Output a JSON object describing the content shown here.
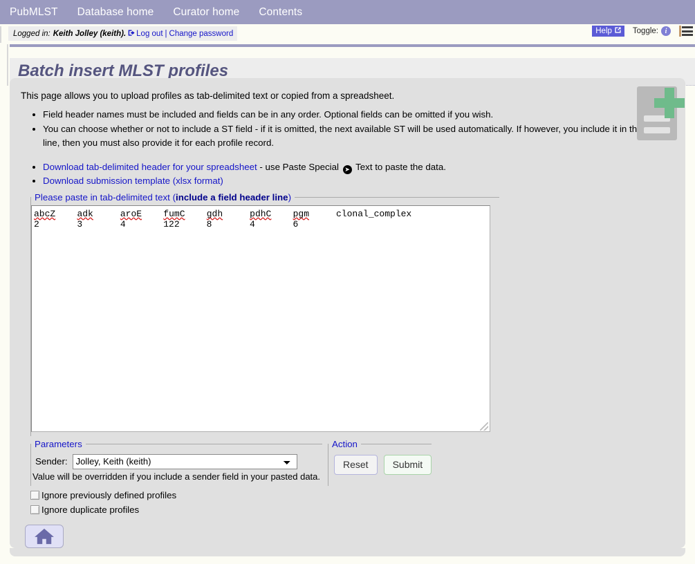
{
  "nav": {
    "items": [
      {
        "label": "PubMLST",
        "name": "nav-pubmlst"
      },
      {
        "label": "Database home",
        "name": "nav-database-home"
      },
      {
        "label": "Curator home",
        "name": "nav-curator-home"
      },
      {
        "label": "Contents",
        "name": "nav-contents"
      }
    ]
  },
  "login_bar": {
    "logged_in_prefix": "Logged in:",
    "user": "Keith Jolley (keith).",
    "logout_label": "Log out",
    "separator": "|",
    "change_password_label": "Change password",
    "help_label": "Help",
    "toggle_label": "Toggle:"
  },
  "page": {
    "title": "Batch insert MLST profiles"
  },
  "intro": {
    "text": "This page allows you to upload profiles as tab-delimited text or copied from a spreadsheet.",
    "bullets": [
      "Field header names must be included and fields can be in any order. Optional fields can be omitted if you wish.",
      "You can choose whether or not to include a ST field - if it is omitted, the next available ST will be used automatically. If however, you include it in the header line, then you must also provide it for each profile record."
    ],
    "download_header_link": "Download tab-delimited header for your spreadsheet",
    "download_header_suffix_before": " - use Paste Special ",
    "download_header_suffix_after": " Text to paste the data.",
    "download_template_link": "Download submission template (xlsx format)"
  },
  "paste": {
    "legend_normal": "Please paste in tab-delimited text (",
    "legend_bold": "include a field header line",
    "legend_end": ")",
    "header_fields": [
      "abcZ",
      "adk",
      "aroE",
      "fumC",
      "gdh",
      "pdhC",
      "pgm",
      "clonal_complex"
    ],
    "values": [
      "2",
      "3",
      "4",
      "122",
      "8",
      "4",
      "6",
      ""
    ]
  },
  "parameters": {
    "legend": "Parameters",
    "sender_label": "Sender:",
    "sender_value": "Jolley, Keith (keith)",
    "sender_note": "Value will be overridden if you include a sender field in your pasted data.",
    "checkboxes": [
      {
        "label": "Ignore previously defined profiles",
        "checked": false
      },
      {
        "label": "Ignore duplicate profiles",
        "checked": false
      }
    ]
  },
  "action": {
    "legend": "Action",
    "reset_label": "Reset",
    "submit_label": "Submit"
  },
  "colors": {
    "nav_bg": "#9b9bc0",
    "link": "#1414c8",
    "title": "#55557f",
    "help_bg": "#5b5bd6",
    "submit_border": "#a9d3a9",
    "reset_border": "#b4b4dc",
    "plus_green": "#6fbb8b"
  }
}
